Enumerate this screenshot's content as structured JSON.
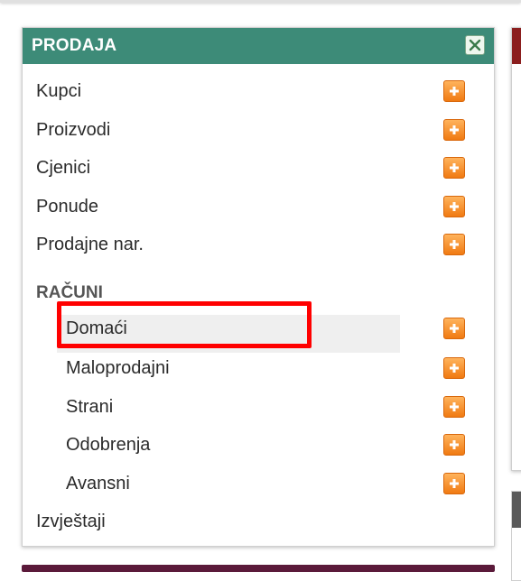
{
  "panel": {
    "title": "PRODAJA",
    "header_color": "#3d8b78",
    "close_icon": "close-icon"
  },
  "menu": {
    "items": [
      {
        "label": "Kupci",
        "icon": "plus-icon"
      },
      {
        "label": "Proizvodi",
        "icon": "plus-icon"
      },
      {
        "label": "Cjenici",
        "icon": "plus-icon"
      },
      {
        "label": "Ponude",
        "icon": "plus-icon"
      },
      {
        "label": "Prodajne nar.",
        "icon": "plus-icon"
      }
    ],
    "section_title": "RAČUNI",
    "sub_items": [
      {
        "label": "Domaći",
        "icon": "plus-icon",
        "active": true
      },
      {
        "label": "Maloprodajni",
        "icon": "plus-icon"
      },
      {
        "label": "Strani",
        "icon": "plus-icon"
      },
      {
        "label": "Odobrenja",
        "icon": "plus-icon"
      },
      {
        "label": "Avansni",
        "icon": "plus-icon"
      }
    ],
    "footer_item": {
      "label": "Izvještaji"
    }
  },
  "colors": {
    "accent": "#f07a12",
    "highlight_box": "#ff0000"
  }
}
